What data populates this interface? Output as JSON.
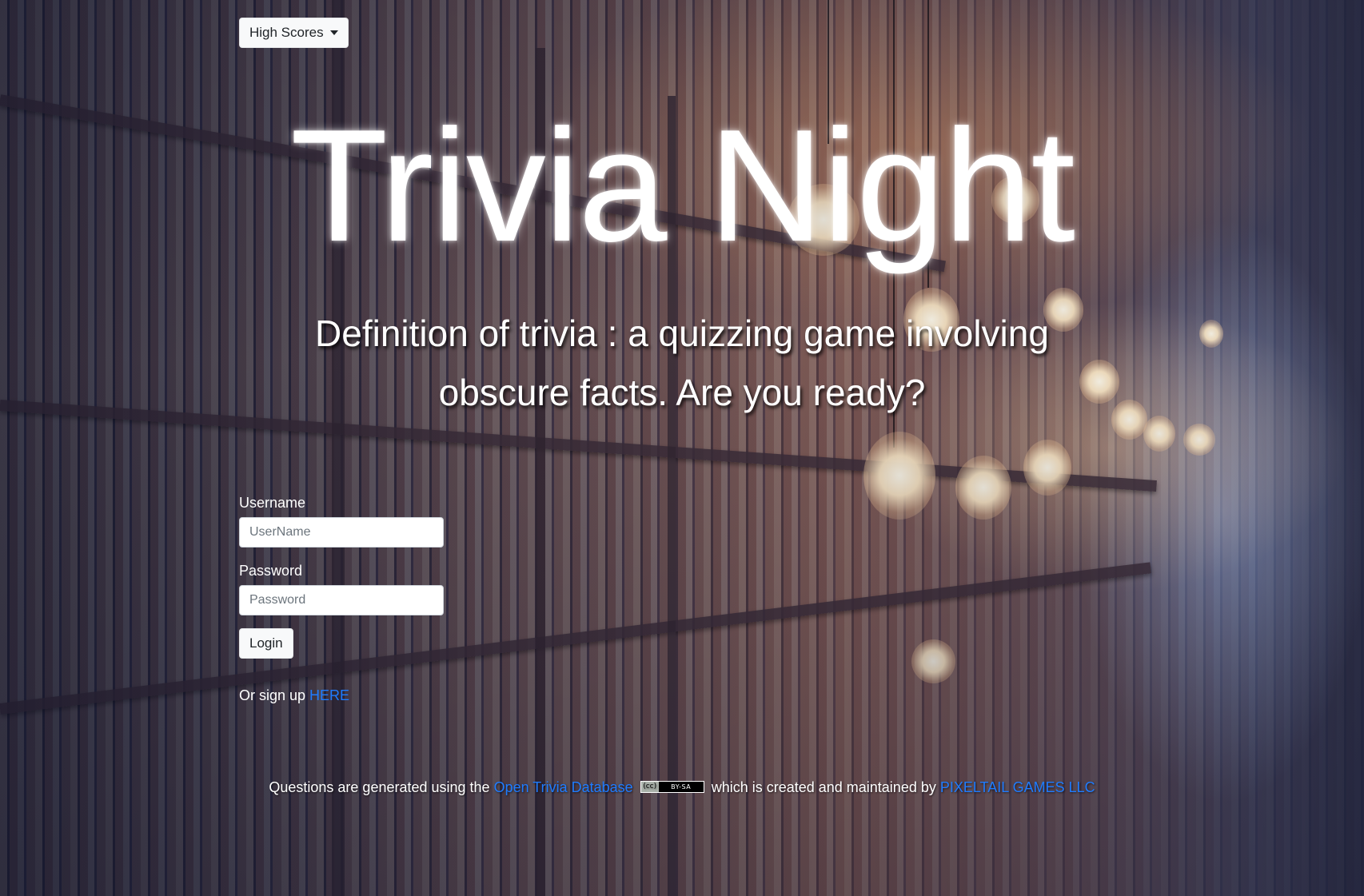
{
  "header": {
    "high_scores_label": "High Scores"
  },
  "hero": {
    "title": "Trivia Night",
    "tagline": "Definition of trivia : a quizzing game involving obscure facts. Are you ready?"
  },
  "login_form": {
    "username_label": "Username",
    "username_placeholder": "UserName",
    "username_value": "",
    "password_label": "Password",
    "password_placeholder": "Password",
    "password_value": "",
    "login_button": "Login"
  },
  "signup": {
    "prefix": "Or sign up ",
    "link_text": "HERE"
  },
  "footer": {
    "text_before": "Questions are generated using the ",
    "database_link": "Open Trivia Database",
    "license_badge": "BY-SA",
    "text_after": " which is created and maintained by ",
    "creator_link": "PIXELTAIL GAMES LLC"
  },
  "colors": {
    "link": "#1f7cff",
    "text": "#ffffff",
    "button_bg": "#f8f9fa"
  },
  "icons": {
    "dropdown": "caret-down-icon",
    "license": "creative-commons-icon"
  }
}
